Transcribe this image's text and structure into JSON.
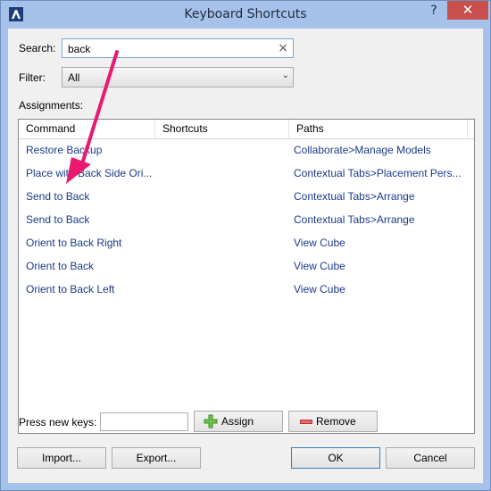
{
  "window": {
    "title": "Keyboard Shortcuts",
    "help": "?",
    "close": "✕"
  },
  "search": {
    "label": "Search:",
    "value": "back",
    "clear": "×"
  },
  "filter": {
    "label": "Filter:",
    "value": "All",
    "arrow": "⌄"
  },
  "assignments_label": "Assignments:",
  "table": {
    "columns": [
      "Command",
      "Shortcuts",
      "Paths"
    ],
    "rows": [
      {
        "command": "Restore Backup",
        "shortcuts": "",
        "path": "Collaborate>Manage Models"
      },
      {
        "command": "Place with Back Side Ori...",
        "shortcuts": "",
        "path": "Contextual Tabs>Placement Pers..."
      },
      {
        "command": "Send to Back",
        "shortcuts": "",
        "path": "Contextual Tabs>Arrange"
      },
      {
        "command": "Send to Back",
        "shortcuts": "",
        "path": "Contextual Tabs>Arrange"
      },
      {
        "command": "Orient to Back Right",
        "shortcuts": "",
        "path": "View Cube"
      },
      {
        "command": "Orient to Back",
        "shortcuts": "",
        "path": "View Cube"
      },
      {
        "command": "Orient to Back Left",
        "shortcuts": "",
        "path": "View Cube"
      }
    ]
  },
  "new_keys": {
    "label": "Press new keys:",
    "value": ""
  },
  "buttons": {
    "assign": "Assign",
    "remove": "Remove",
    "import": "Import...",
    "export": "Export...",
    "ok": "OK",
    "cancel": "Cancel"
  },
  "colors": {
    "title_bar": "#a6c2ea",
    "close": "#c7504c",
    "link_text": "#1a3a8a",
    "annotation_arrow": "#e8196e"
  }
}
